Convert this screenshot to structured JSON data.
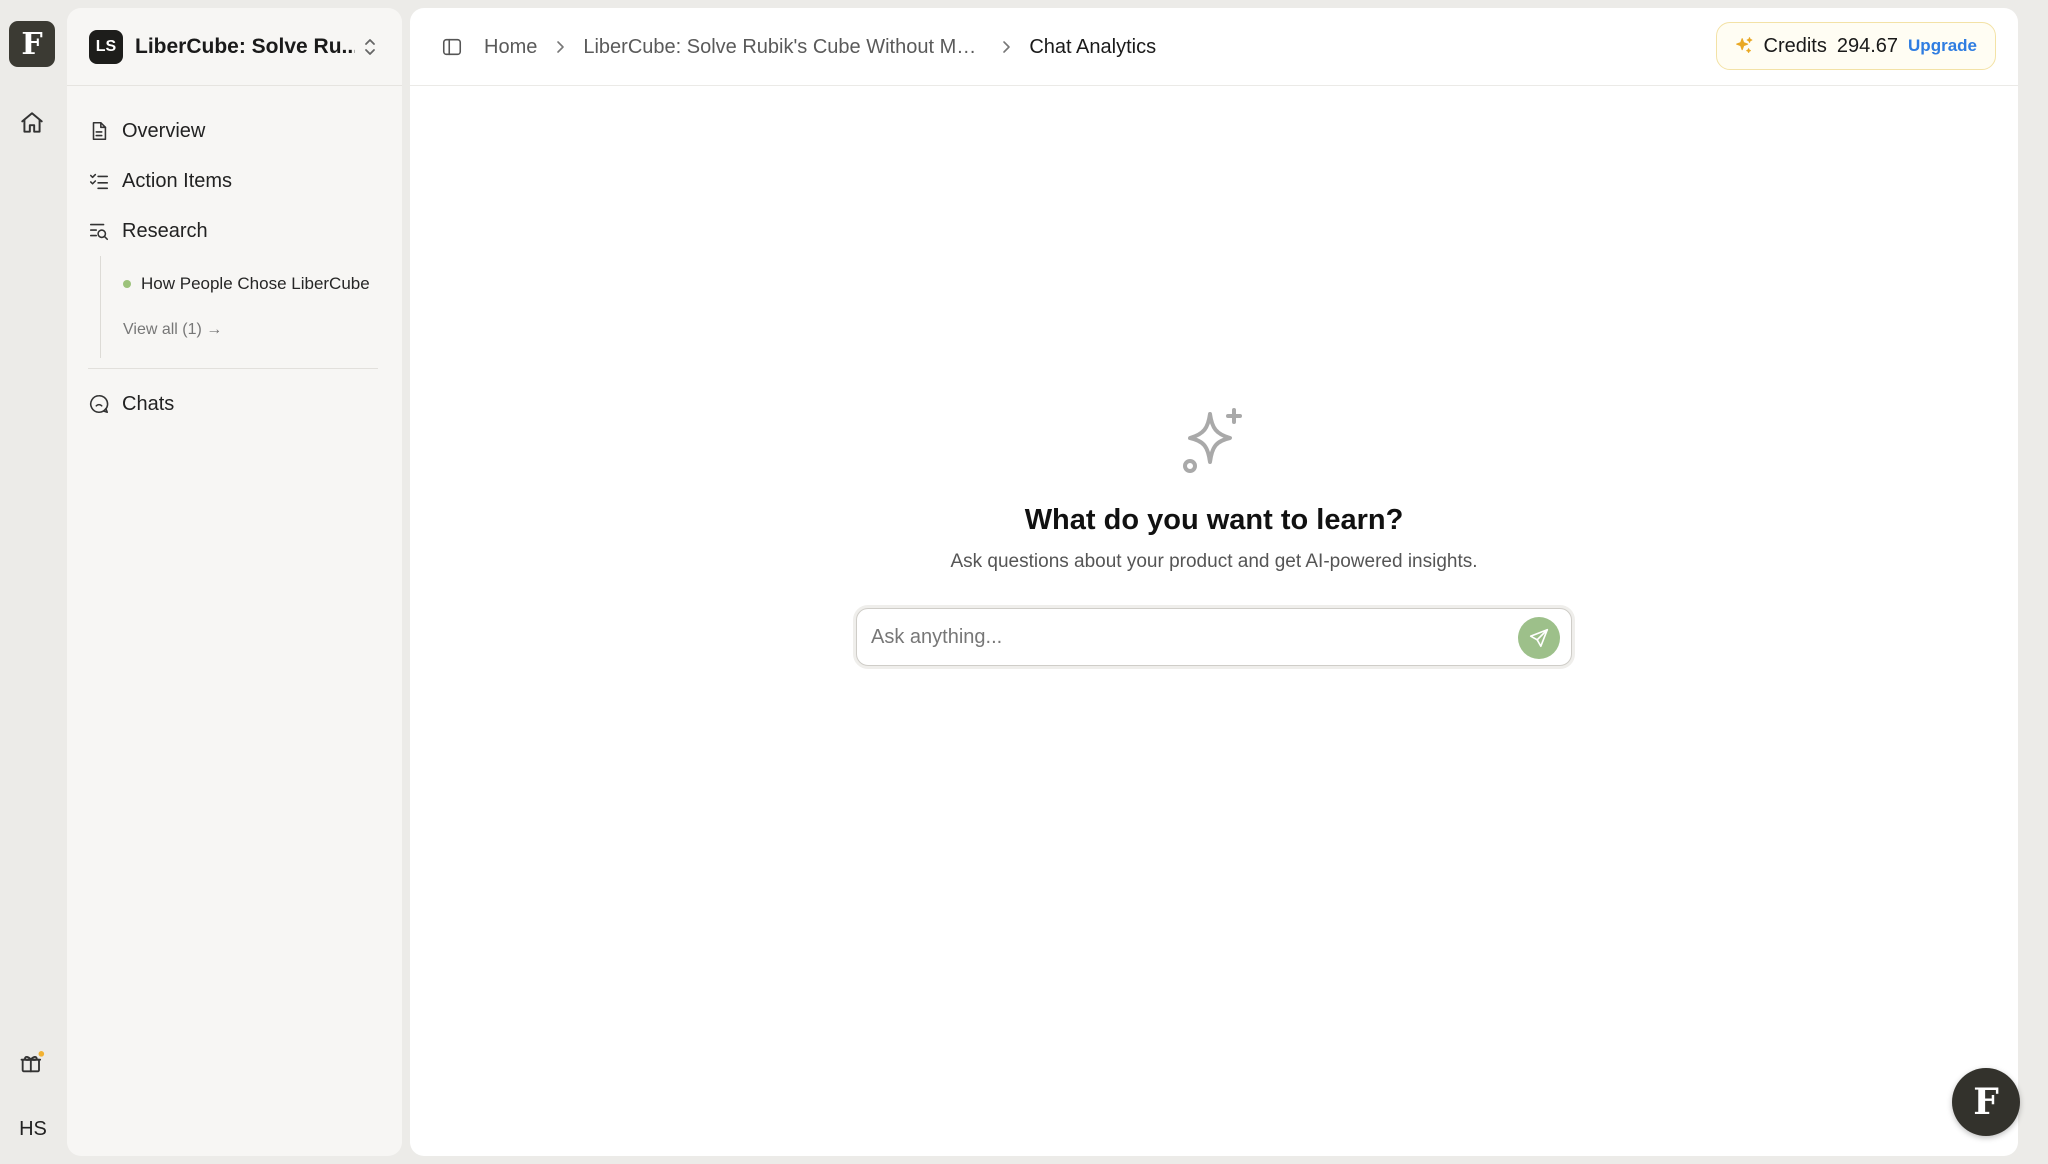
{
  "rail": {
    "logo_letter": "F",
    "home_icon": "home-icon",
    "gift_icon": "gift-icon",
    "user_initials": "HS"
  },
  "sidebar": {
    "project": {
      "badge": "LS",
      "name": "LiberCube: Solve Ru..."
    },
    "nav": [
      {
        "label": "Overview",
        "icon": "document-icon"
      },
      {
        "label": "Action Items",
        "icon": "checklist-icon"
      },
      {
        "label": "Research",
        "icon": "search-list-icon"
      }
    ],
    "research_items": [
      {
        "label": "How People Chose LiberCube"
      }
    ],
    "view_all": "View all (1) →",
    "chats": {
      "label": "Chats",
      "icon": "chat-icon"
    }
  },
  "topbar": {
    "breadcrumb": {
      "home": "Home",
      "project": "LiberCube: Solve Rubik's Cube Without Me...",
      "current": "Chat Analytics"
    },
    "credits": {
      "label": "Credits",
      "value": "294.67",
      "upgrade": "Upgrade"
    }
  },
  "empty_state": {
    "title": "What do you want to learn?",
    "subtitle": "Ask questions about your product and get AI-powered insights."
  },
  "ask": {
    "placeholder": "Ask anything...",
    "value": ""
  },
  "fab": {
    "letter": "F"
  },
  "colors": {
    "accent_green": "#9dc08a",
    "upgrade_blue": "#2f7de1",
    "credits_border": "#f3e2a6",
    "dark": "#33322c"
  }
}
